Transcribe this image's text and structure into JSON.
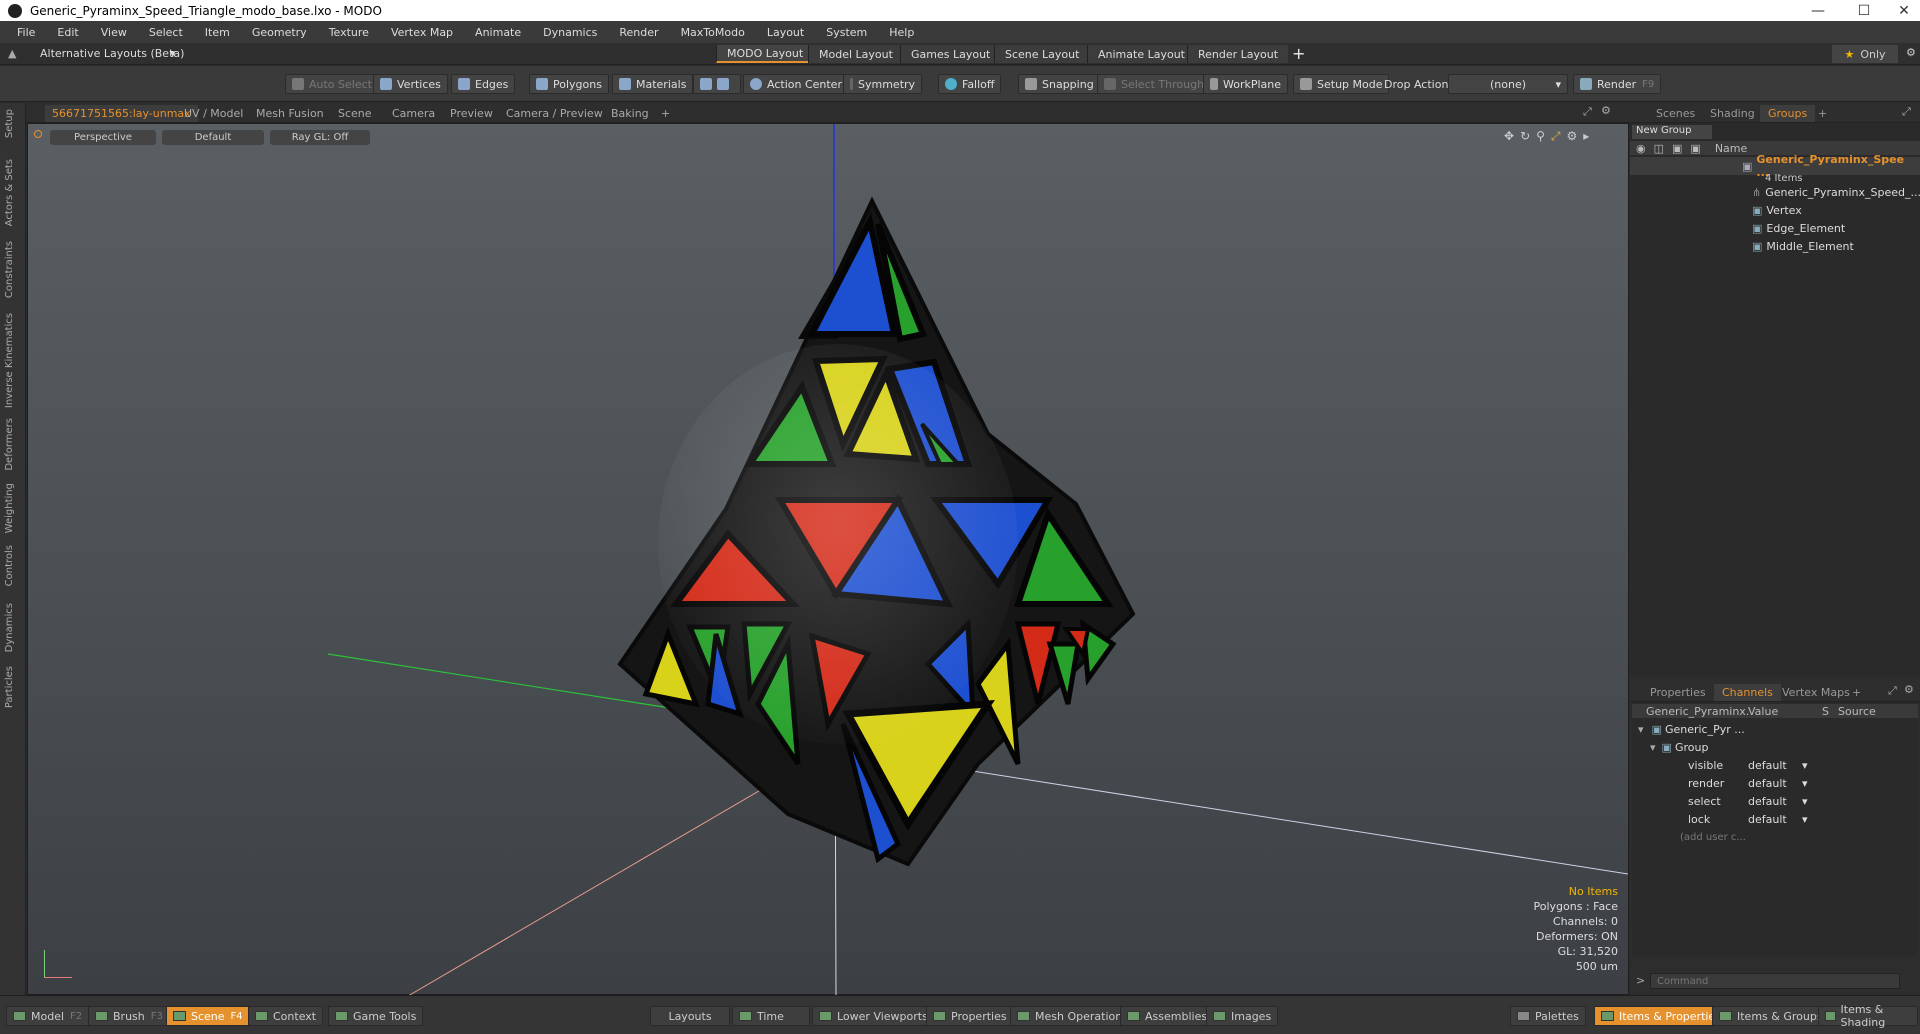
{
  "window": {
    "title": "Generic_Pyraminx_Speed_Triangle_modo_base.lxo - MODO"
  },
  "menu": [
    "File",
    "Edit",
    "View",
    "Select",
    "Item",
    "Geometry",
    "Texture",
    "Vertex Map",
    "Animate",
    "Dynamics",
    "Render",
    "MaxToModo",
    "Layout",
    "System",
    "Help"
  ],
  "layoutbar": {
    "alt_layouts": "Alternative Layouts (Beta)",
    "tabs": [
      "MODO Layout",
      "Model Layout",
      "Games Layout",
      "Scene Layout",
      "Animate Layout",
      "Render Layout"
    ],
    "add": "+",
    "only_label": "Only"
  },
  "toolbar": {
    "auto_select": "Auto Select",
    "vertices": "Vertices",
    "edges": "Edges",
    "polygons": "Polygons",
    "materials": "Materials",
    "action_center": "Action Center",
    "symmetry": "Symmetry",
    "falloff": "Falloff",
    "snapping": "Snapping",
    "select_through": "Select Through",
    "workplane": "WorkPlane",
    "setup_mode": "Setup Mode",
    "drop_action": "Drop Action",
    "drop_value": "(none)",
    "render": "Render"
  },
  "left_tabs": [
    "Setup",
    "Actors & Sets",
    "Constraints",
    "Inverse Kinematics",
    "Deformers",
    "Weighting",
    "Controls",
    "Dynamics",
    "Particles"
  ],
  "viewport_tabs": [
    "56671751565:lay-unmax",
    "UV / Model",
    "Mesh Fusion",
    "Scene",
    "Camera",
    "Preview",
    "Camera / Preview",
    "Baking",
    "+"
  ],
  "viewport": {
    "view": "Perspective",
    "shading": "Default",
    "raygl": "Ray GL: Off",
    "stats": {
      "items": "No Items",
      "polygons": "Polygons : Face",
      "channels": "Channels: 0",
      "deformers": "Deformers: ON",
      "gl": "GL: 31,520",
      "scale": "500 um"
    }
  },
  "groups_panel": {
    "tabs": [
      "Scenes",
      "Shading",
      "Groups",
      "+"
    ],
    "new_group": "New Group",
    "name_header": "Name",
    "root": {
      "name": "Generic_Pyraminx_Spee ...",
      "count": "4 Items"
    },
    "children": [
      "Generic_Pyraminx_Speed_...",
      "Vertex",
      "Edge_Element",
      "Middle_Element"
    ]
  },
  "channels_panel": {
    "tabs": [
      "Properties",
      "Channels",
      "Vertex Maps",
      "+"
    ],
    "headers": {
      "name": "Generic_Pyraminx...",
      "value": "Value",
      "s": "S",
      "source": "Source"
    },
    "item": "Generic_Pyr ...",
    "group": "Group",
    "rows": [
      {
        "name": "visible",
        "value": "default"
      },
      {
        "name": "render",
        "value": "default"
      },
      {
        "name": "select",
        "value": "default"
      },
      {
        "name": "lock",
        "value": "default"
      }
    ],
    "add_user": "(add user c...",
    "command_placeholder": "Command"
  },
  "bottom_bar": {
    "model": "Model",
    "model_key": "F2",
    "brush": "Brush",
    "brush_key": "F3",
    "scene": "Scene",
    "scene_key": "F4",
    "context": "Context",
    "game_tools": "Game Tools",
    "layouts": "Layouts",
    "time": "Time",
    "lower_viewports": "Lower Viewports",
    "properties": "Properties",
    "mesh_operations": "Mesh Operations",
    "assemblies": "Assemblies",
    "images": "Images",
    "palettes": "Palettes",
    "items_properties": "Items & Properties",
    "items_groups": "Items & Groups",
    "items_shading": "Items & Shading"
  },
  "colors": {
    "accent": "#e5912d",
    "red": "#d42a18",
    "green": "#27a12b",
    "blue": "#1d4fd1",
    "yellow": "#d8d21a"
  }
}
